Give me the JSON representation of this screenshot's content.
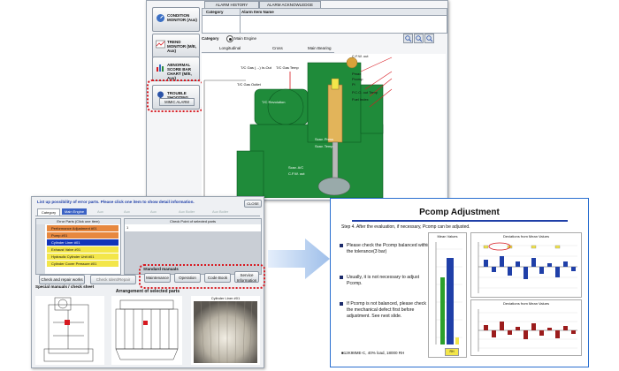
{
  "cm_window": {
    "tabs": [
      "ALARM HISTORY",
      "ALARM ACKNOWLEDGE"
    ],
    "sidebar": [
      {
        "label": "CONDITION MONITOR (Aux)"
      },
      {
        "label": "TREND MONITOR (M/E, Aux)"
      },
      {
        "label": "ABNORMAL SCORE BAR CHART (M/E, Aux)"
      },
      {
        "label": "TROUBLE SHOOTING"
      }
    ],
    "mimic_alarm_label": "MIMIC ALARM",
    "table_headers": {
      "category": "Category",
      "alarm_item": "Alarm Item Name"
    },
    "category_label": "Category",
    "category_value": "Main Engine",
    "section_tabs": [
      "Longitudinal",
      "Cross",
      "Main Bearing"
    ],
    "engine_labels": {
      "tc_gas_in_out": "T/C Gas (→) In-Out",
      "tc_gas_temp": "T/C Gas Temp",
      "tc_gas_outlet": "T/C Gas Outlet",
      "tc_revolution": "T/C Revolution",
      "cfw_out": "C.F.W. out",
      "pmax": "Pmax",
      "pcomp": "Pcomp",
      "pi": "Pi",
      "pco_out_temp": "P.C.O. out Temp",
      "fuel_index": "Fuel Index",
      "scav_press": "Scav. Press",
      "scav_temp": "Scav. Temp",
      "scav_ac": "Scav. A/C",
      "cfw_out_low": "C.F.W. out"
    }
  },
  "parts_window": {
    "header": "List up possibility of error parts. Please click one item to show detail information.",
    "close_label": "CLOSE",
    "category_tab": "Category",
    "category_selected": "Main Engine",
    "disabled_tabs": [
      "Aux",
      "Aux",
      "Aux",
      "Aux Boiler",
      "Aux Boiler"
    ],
    "list_header": "Error Parts (Click one item)",
    "check_header": "Check Point of selected parts",
    "parts": [
      {
        "text": "Performance Adjustment #01",
        "color": "#e7883f"
      },
      {
        "text": "Pump #01",
        "color": "#e7883f"
      },
      {
        "text": "Cylinder Liner #01",
        "color": "#1234b8"
      },
      {
        "text": "Exhaust Valve #01",
        "color": "#f3e64a"
      },
      {
        "text": "Hydraulic Cylinder Unit #01",
        "color": "#f3e64a"
      },
      {
        "text": "Cylinder Cover Pressure #01",
        "color": "#f3e64a"
      }
    ],
    "check_item_number": "1",
    "buttons": [
      "Check and repair works",
      "Check Ident/Repair"
    ],
    "special_manuals_title": "Special manuals / check sheet",
    "standard_manuals_title": "Standard manuals",
    "manual_buttons": [
      "Maintenance",
      "Operation",
      "Code Book",
      "Service Information"
    ],
    "arrangement_title": "Arrangement of selected parts",
    "photo_caption": "Cylinder Liner #01"
  },
  "slide": {
    "title": "Pcomp Adjustment",
    "step": "Step 4. After the evaluation, if necessary, Pcomp can be adjusted.",
    "bullets": [
      "Please check the Pcomp balanced within the tolerance(3 bar)",
      "Usually, it is not necessary to adjust Pcomp.",
      "If Pcomp is not balanced, please check the mechanical defect first before adjustment. See next slide."
    ],
    "footnote": "12K98ME-C, 40% load, 18000 RH",
    "mean_values_title": "Mean Values",
    "mean_bar_label": "RH",
    "deviation_title_1": "Deviations from Mean Values",
    "deviation_title_2": "Deviations from Mean Values",
    "colors": {
      "accent": "#1f3fa8",
      "frame": "#2a6fd0",
      "alert": "#d71920"
    }
  }
}
